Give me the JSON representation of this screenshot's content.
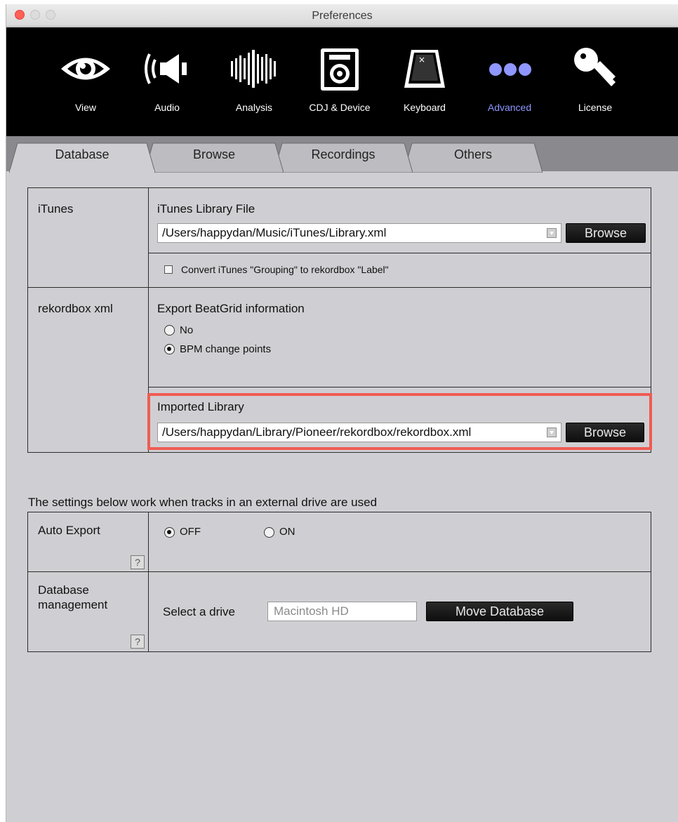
{
  "window": {
    "title": "Preferences"
  },
  "toolbar": {
    "items": [
      {
        "label": "View",
        "icon": "eye-icon"
      },
      {
        "label": "Audio",
        "icon": "speaker-icon"
      },
      {
        "label": "Analysis",
        "icon": "waveform-bars-icon"
      },
      {
        "label": "CDJ & Device",
        "icon": "speaker-device-icon"
      },
      {
        "label": "Keyboard",
        "icon": "keyboard-key-icon"
      },
      {
        "label": "Advanced",
        "icon": "three-dots-icon",
        "active": true
      },
      {
        "label": "License",
        "icon": "key-icon"
      }
    ],
    "active_color": "#8f96ff"
  },
  "tabs": [
    {
      "label": "Database",
      "active": true
    },
    {
      "label": "Browse"
    },
    {
      "label": "Recordings"
    },
    {
      "label": "Others"
    }
  ],
  "itunes": {
    "section_label": "iTunes",
    "library_file_label": "iTunes Library File",
    "library_path": "/Users/happydan/Music/iTunes/Library.xml",
    "browse_label": "Browse",
    "convert_grouping_label": "Convert iTunes \"Grouping\" to rekordbox \"Label\"",
    "convert_grouping_checked": false
  },
  "rekordbox_xml": {
    "section_label": "rekordbox xml",
    "export_beatgrid_label": "Export BeatGrid information",
    "options": [
      {
        "label": "No",
        "selected": false
      },
      {
        "label": "BPM change points",
        "selected": true
      }
    ],
    "imported_library_label": "Imported Library",
    "imported_library_path": "/Users/happydan/Library/Pioneer/rekordbox/rekordbox.xml",
    "browse_label": "Browse",
    "highlight_color": "#ef5b52"
  },
  "external": {
    "note": "The settings below work when tracks in an external drive are used",
    "auto_export": {
      "label": "Auto Export",
      "options": [
        {
          "label": "OFF",
          "selected": true
        },
        {
          "label": "ON",
          "selected": false
        }
      ],
      "help": "?"
    },
    "database_management": {
      "label_line1": "Database",
      "label_line2": "management",
      "select_drive_label": "Select a drive",
      "drive_placeholder": "Macintosh HD",
      "move_button_label": "Move Database",
      "help": "?"
    }
  }
}
